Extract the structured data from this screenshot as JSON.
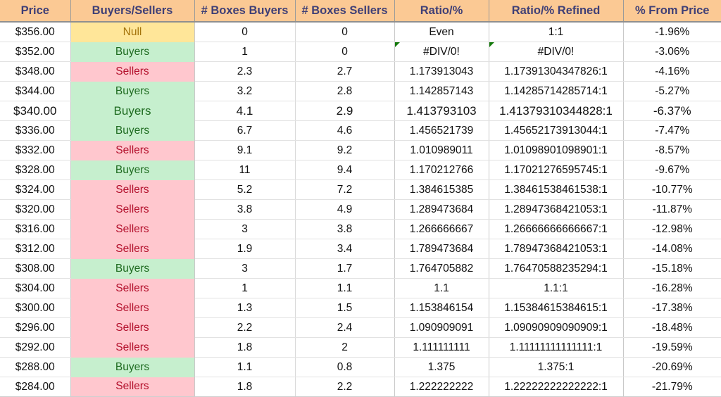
{
  "table": {
    "columns": [
      "Price",
      "Buyers/Sellers",
      "# Boxes Buyers",
      "# Boxes Sellers",
      "Ratio/%",
      "Ratio/% Refined",
      "% From Price"
    ],
    "header_bg": "#FBC994",
    "header_text_color": "#3F3F76",
    "fill_colors": {
      "buyers_bg": "#C6EFCE",
      "buyers_text": "#1E6B20",
      "sellers_bg": "#FFC7CE",
      "sellers_text": "#B30F2B",
      "null_bg": "#FFE699",
      "null_text": "#A4730A"
    },
    "error_flag_color": "#13790B",
    "rows": [
      {
        "price": "$356.00",
        "status": "Null",
        "status_fill": "null",
        "boxes_buyers": "0",
        "boxes_sellers": "0",
        "ratio": "Even",
        "ratio_refined": "1:1",
        "pct_from_price": "-1.96%",
        "ratio_error_flag": false,
        "ratio_refined_error_flag": false,
        "big_text": false
      },
      {
        "price": "$352.00",
        "status": "Buyers",
        "status_fill": "buyers",
        "boxes_buyers": "1",
        "boxes_sellers": "0",
        "ratio": "#DIV/0!",
        "ratio_refined": "#DIV/0!",
        "pct_from_price": "-3.06%",
        "ratio_error_flag": true,
        "ratio_refined_error_flag": true,
        "big_text": false
      },
      {
        "price": "$348.00",
        "status": "Sellers",
        "status_fill": "sellers",
        "boxes_buyers": "2.3",
        "boxes_sellers": "2.7",
        "ratio": "1.173913043",
        "ratio_refined": "1.17391304347826:1",
        "pct_from_price": "-4.16%",
        "ratio_error_flag": false,
        "ratio_refined_error_flag": false,
        "big_text": false
      },
      {
        "price": "$344.00",
        "status": "Buyers",
        "status_fill": "buyers",
        "boxes_buyers": "3.2",
        "boxes_sellers": "2.8",
        "ratio": "1.142857143",
        "ratio_refined": "1.14285714285714:1",
        "pct_from_price": "-5.27%",
        "ratio_error_flag": false,
        "ratio_refined_error_flag": false,
        "big_text": false
      },
      {
        "price": "$340.00",
        "status": "Buyers",
        "status_fill": "buyers",
        "boxes_buyers": "4.1",
        "boxes_sellers": "2.9",
        "ratio": "1.413793103",
        "ratio_refined": "1.41379310344828:1",
        "pct_from_price": "-6.37%",
        "ratio_error_flag": false,
        "ratio_refined_error_flag": false,
        "big_text": true
      },
      {
        "price": "$336.00",
        "status": "Buyers",
        "status_fill": "buyers",
        "boxes_buyers": "6.7",
        "boxes_sellers": "4.6",
        "ratio": "1.456521739",
        "ratio_refined": "1.45652173913044:1",
        "pct_from_price": "-7.47%",
        "ratio_error_flag": false,
        "ratio_refined_error_flag": false,
        "big_text": false
      },
      {
        "price": "$332.00",
        "status": "Sellers",
        "status_fill": "sellers",
        "boxes_buyers": "9.1",
        "boxes_sellers": "9.2",
        "ratio": "1.010989011",
        "ratio_refined": "1.01098901098901:1",
        "pct_from_price": "-8.57%",
        "ratio_error_flag": false,
        "ratio_refined_error_flag": false,
        "big_text": false
      },
      {
        "price": "$328.00",
        "status": "Buyers",
        "status_fill": "buyers",
        "boxes_buyers": "11",
        "boxes_sellers": "9.4",
        "ratio": "1.170212766",
        "ratio_refined": "1.17021276595745:1",
        "pct_from_price": "-9.67%",
        "ratio_error_flag": false,
        "ratio_refined_error_flag": false,
        "big_text": false
      },
      {
        "price": "$324.00",
        "status": "Sellers",
        "status_fill": "sellers",
        "boxes_buyers": "5.2",
        "boxes_sellers": "7.2",
        "ratio": "1.384615385",
        "ratio_refined": "1.38461538461538:1",
        "pct_from_price": "-10.77%",
        "ratio_error_flag": false,
        "ratio_refined_error_flag": false,
        "big_text": false
      },
      {
        "price": "$320.00",
        "status": "Sellers",
        "status_fill": "sellers",
        "boxes_buyers": "3.8",
        "boxes_sellers": "4.9",
        "ratio": "1.289473684",
        "ratio_refined": "1.28947368421053:1",
        "pct_from_price": "-11.87%",
        "ratio_error_flag": false,
        "ratio_refined_error_flag": false,
        "big_text": false
      },
      {
        "price": "$316.00",
        "status": "Sellers",
        "status_fill": "sellers",
        "boxes_buyers": "3",
        "boxes_sellers": "3.8",
        "ratio": "1.266666667",
        "ratio_refined": "1.26666666666667:1",
        "pct_from_price": "-12.98%",
        "ratio_error_flag": false,
        "ratio_refined_error_flag": false,
        "big_text": false
      },
      {
        "price": "$312.00",
        "status": "Sellers",
        "status_fill": "sellers",
        "boxes_buyers": "1.9",
        "boxes_sellers": "3.4",
        "ratio": "1.789473684",
        "ratio_refined": "1.78947368421053:1",
        "pct_from_price": "-14.08%",
        "ratio_error_flag": false,
        "ratio_refined_error_flag": false,
        "big_text": false
      },
      {
        "price": "$308.00",
        "status": "Buyers",
        "status_fill": "buyers",
        "boxes_buyers": "3",
        "boxes_sellers": "1.7",
        "ratio": "1.764705882",
        "ratio_refined": "1.76470588235294:1",
        "pct_from_price": "-15.18%",
        "ratio_error_flag": false,
        "ratio_refined_error_flag": false,
        "big_text": false
      },
      {
        "price": "$304.00",
        "status": "Sellers",
        "status_fill": "sellers",
        "boxes_buyers": "1",
        "boxes_sellers": "1.1",
        "ratio": "1.1",
        "ratio_refined": "1.1:1",
        "pct_from_price": "-16.28%",
        "ratio_error_flag": false,
        "ratio_refined_error_flag": false,
        "big_text": false
      },
      {
        "price": "$300.00",
        "status": "Sellers",
        "status_fill": "sellers",
        "boxes_buyers": "1.3",
        "boxes_sellers": "1.5",
        "ratio": "1.153846154",
        "ratio_refined": "1.15384615384615:1",
        "pct_from_price": "-17.38%",
        "ratio_error_flag": false,
        "ratio_refined_error_flag": false,
        "big_text": false
      },
      {
        "price": "$296.00",
        "status": "Sellers",
        "status_fill": "sellers",
        "boxes_buyers": "2.2",
        "boxes_sellers": "2.4",
        "ratio": "1.090909091",
        "ratio_refined": "1.09090909090909:1",
        "pct_from_price": "-18.48%",
        "ratio_error_flag": false,
        "ratio_refined_error_flag": false,
        "big_text": false
      },
      {
        "price": "$292.00",
        "status": "Sellers",
        "status_fill": "sellers",
        "boxes_buyers": "1.8",
        "boxes_sellers": "2",
        "ratio": "1.111111111",
        "ratio_refined": "1.11111111111111:1",
        "pct_from_price": "-19.59%",
        "ratio_error_flag": false,
        "ratio_refined_error_flag": false,
        "big_text": false
      },
      {
        "price": "$288.00",
        "status": "Buyers",
        "status_fill": "buyers",
        "boxes_buyers": "1.1",
        "boxes_sellers": "0.8",
        "ratio": "1.375",
        "ratio_refined": "1.375:1",
        "pct_from_price": "-20.69%",
        "ratio_error_flag": false,
        "ratio_refined_error_flag": false,
        "big_text": false
      },
      {
        "price": "$284.00",
        "status": "Sellers",
        "status_fill": "sellers",
        "boxes_buyers": "1.8",
        "boxes_sellers": "2.2",
        "ratio": "1.222222222",
        "ratio_refined": "1.22222222222222:1",
        "pct_from_price": "-21.79%",
        "ratio_error_flag": false,
        "ratio_refined_error_flag": false,
        "big_text": false
      }
    ]
  }
}
